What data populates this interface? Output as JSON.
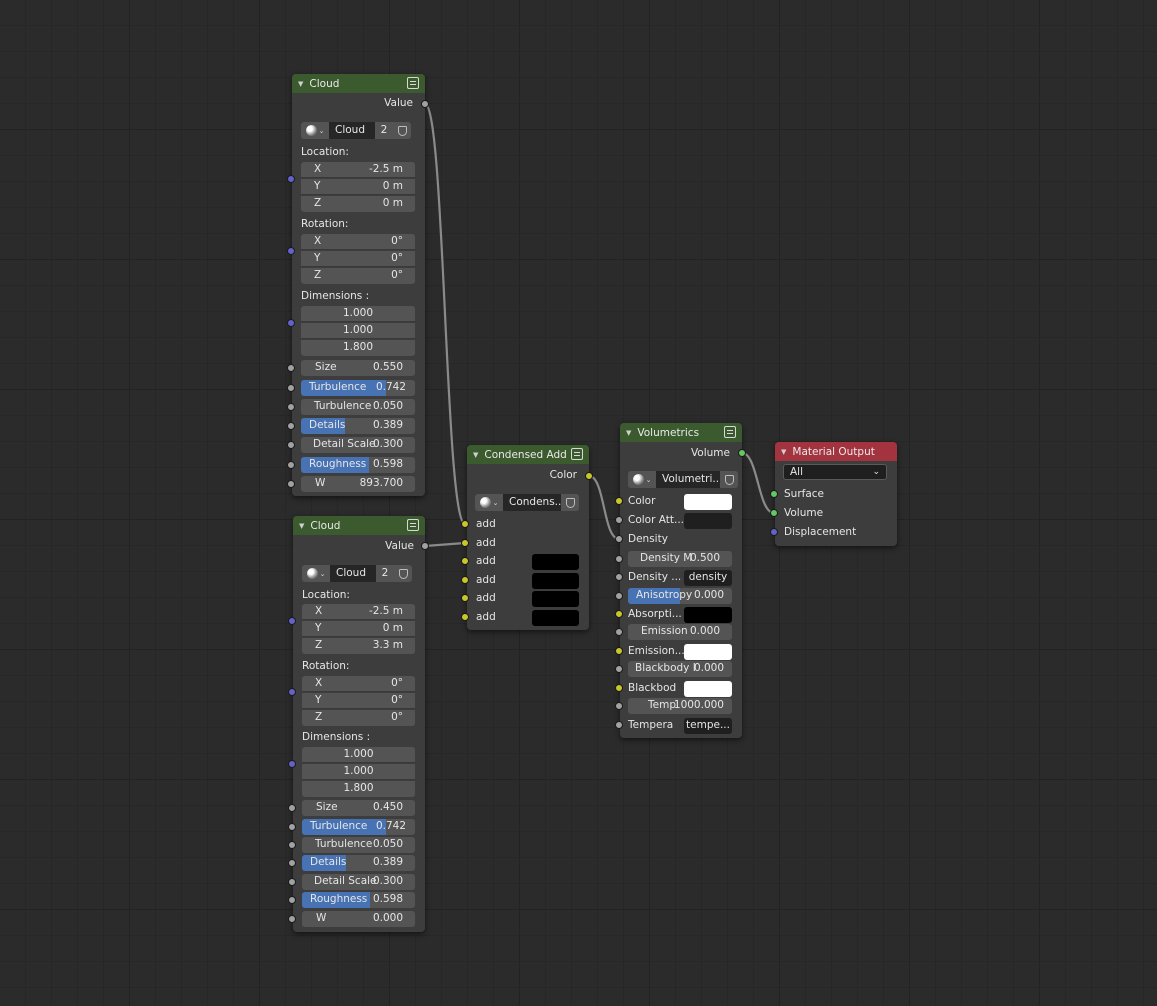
{
  "cloud1": {
    "title": "Cloud",
    "output_value": "Value",
    "datablock": {
      "name": "Cloud",
      "users": "2"
    },
    "location_label": "Location:",
    "location": {
      "x_label": "X",
      "x": "-2.5 m",
      "y_label": "Y",
      "y": "0 m",
      "z_label": "Z",
      "z": "0 m"
    },
    "rotation_label": "Rotation:",
    "rotation": {
      "x_label": "X",
      "x": "0°",
      "y_label": "Y",
      "y": "0°",
      "z_label": "Z",
      "z": "0°"
    },
    "dimensions_label": "Dimensions :",
    "dimensions": [
      "1.000",
      "1.000",
      "1.800"
    ],
    "size": {
      "label": "Size",
      "value": "0.550"
    },
    "turbulence1": {
      "label": "Turbulence",
      "value": "0.742",
      "fill": 0.742
    },
    "turbulence2": {
      "label": "Turbulence",
      "value": "0.050"
    },
    "details": {
      "label": "Details",
      "value": "0.389",
      "fill": 0.389
    },
    "detail_scale": {
      "label": "Detail Scale",
      "value": "0.300"
    },
    "roughness": {
      "label": "Roughness",
      "value": "0.598",
      "fill": 0.598
    },
    "w": {
      "label": "W",
      "value": "893.700"
    }
  },
  "cloud2": {
    "title": "Cloud",
    "output_value": "Value",
    "datablock": {
      "name": "Cloud",
      "users": "2"
    },
    "location_label": "Location:",
    "location": {
      "x_label": "X",
      "x": "-2.5 m",
      "y_label": "Y",
      "y": "0 m",
      "z_label": "Z",
      "z": "3.3 m"
    },
    "rotation_label": "Rotation:",
    "rotation": {
      "x_label": "X",
      "x": "0°",
      "y_label": "Y",
      "y": "0°",
      "z_label": "Z",
      "z": "0°"
    },
    "dimensions_label": "Dimensions :",
    "dimensions": [
      "1.000",
      "1.000",
      "1.800"
    ],
    "size": {
      "label": "Size",
      "value": "0.450"
    },
    "turbulence1": {
      "label": "Turbulence",
      "value": "0.742",
      "fill": 0.742
    },
    "turbulence2": {
      "label": "Turbulence",
      "value": "0.050"
    },
    "details": {
      "label": "Details",
      "value": "0.389",
      "fill": 0.389
    },
    "detail_scale": {
      "label": "Detail Scale",
      "value": "0.300"
    },
    "roughness": {
      "label": "Roughness",
      "value": "0.598",
      "fill": 0.598
    },
    "w": {
      "label": "W",
      "value": "0.000"
    }
  },
  "condensed_add": {
    "title": "Condensed Add",
    "output_color": "Color",
    "datablock": {
      "name": "Condens..."
    },
    "inputs": [
      "add",
      "add",
      "add",
      "add",
      "add",
      "add"
    ]
  },
  "volumetrics": {
    "title": "Volumetrics",
    "output_volume": "Volume",
    "datablock": {
      "name": "Volumetri..."
    },
    "color": "Color",
    "color_att": "Color Att...",
    "density": "Density",
    "density_m": {
      "label": "Density M",
      "value": "0.500"
    },
    "density_attr": {
      "label": "Density ...",
      "value": "density"
    },
    "anisotropy": {
      "label": "Anisotropy",
      "value": "0.000",
      "fill": 0.5
    },
    "absorption": "Absorpti...",
    "emission": {
      "label": "Emission",
      "value": "0.000"
    },
    "emission_color": "Emission...",
    "blackbody_i": {
      "label": "Blackbody I",
      "value": "0.000"
    },
    "blackbody_color": "Blackbod",
    "temp": {
      "label": "Temp",
      "value": "1000.000"
    },
    "tempera": {
      "label": "Tempera",
      "value": "tempe..."
    }
  },
  "material_output": {
    "title": "Material Output",
    "target": "All",
    "surface": "Surface",
    "volume": "Volume",
    "displacement": "Displacement"
  },
  "colors": {
    "header_shader": "#3b5a2d",
    "header_output": "#a3333f",
    "socket_float": "#a1a1a1",
    "socket_vector": "#6363c7",
    "socket_color": "#c7c729",
    "socket_shader": "#63c763",
    "slider_fill": "#4772b3"
  }
}
